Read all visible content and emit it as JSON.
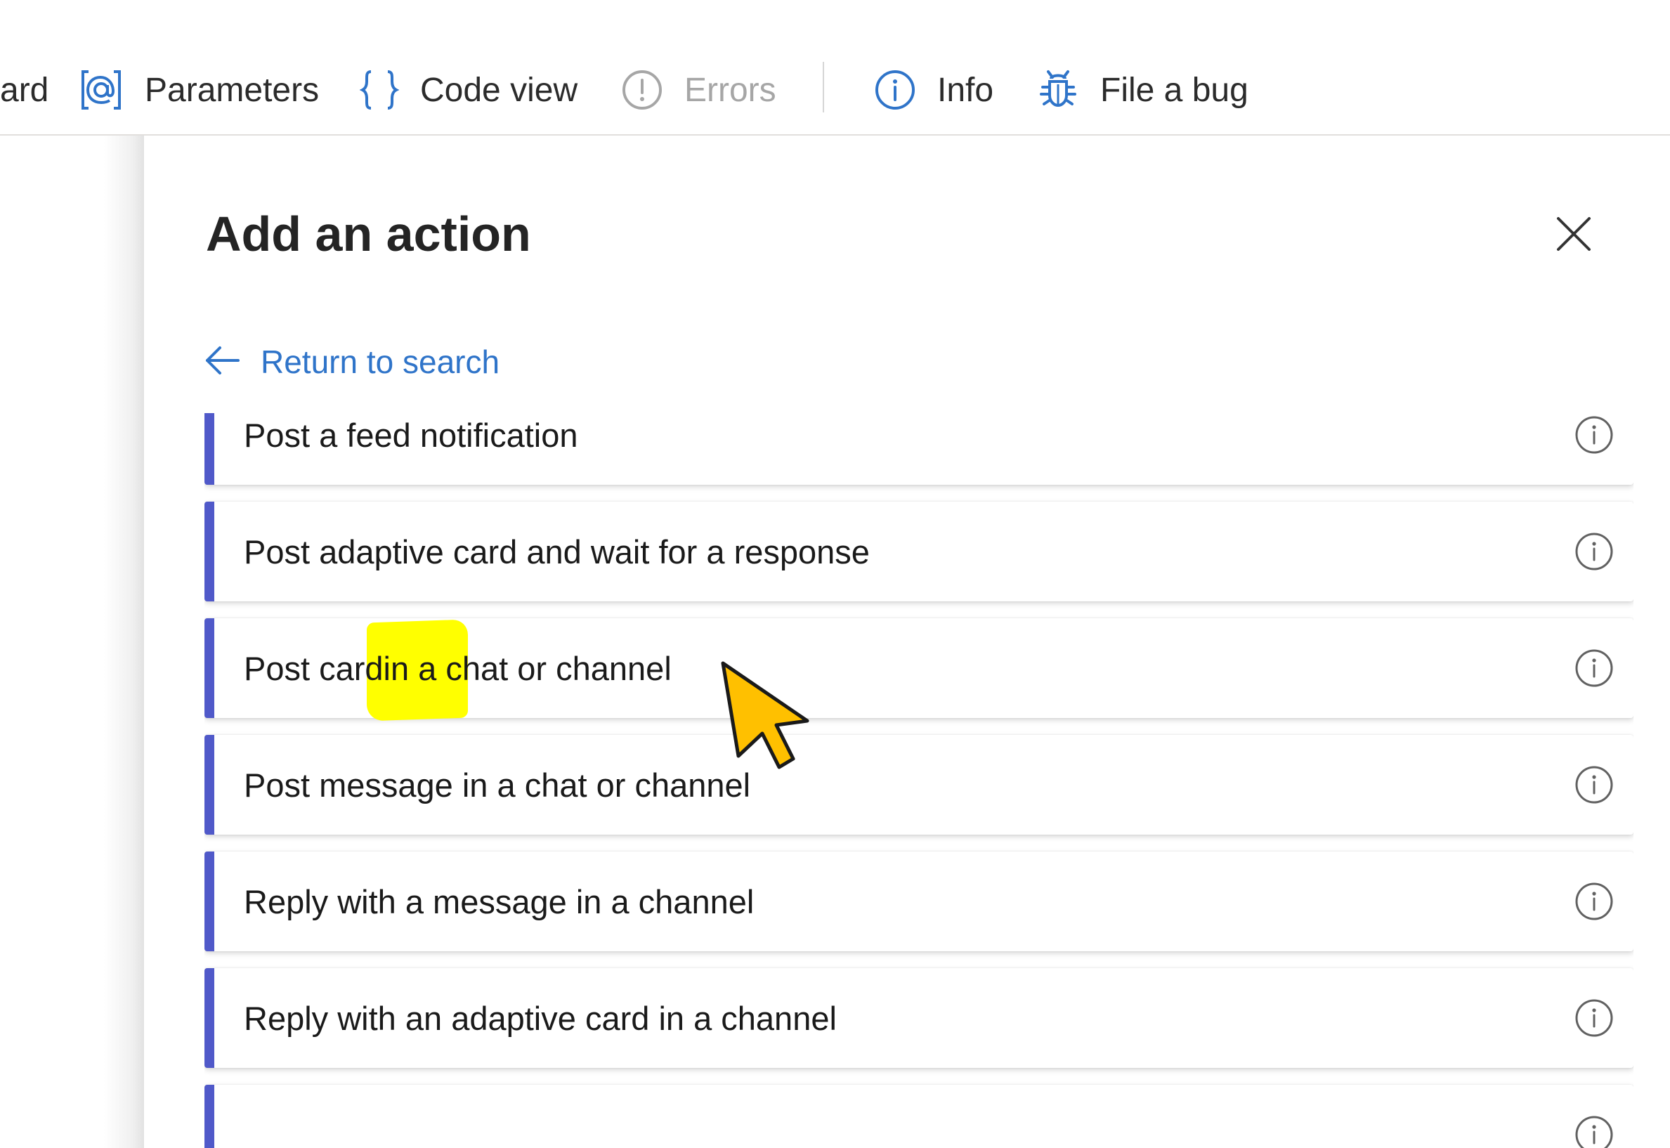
{
  "toolbar": {
    "items": [
      {
        "label": "ard",
        "icon": "none"
      },
      {
        "label": "Parameters",
        "icon": "parameters-icon"
      },
      {
        "label": "Code view",
        "icon": "braces-icon"
      },
      {
        "label": "Errors",
        "icon": "error-icon",
        "state": "disabled"
      },
      {
        "label": "Info",
        "icon": "info-icon"
      },
      {
        "label": "File a bug",
        "icon": "bug-icon"
      }
    ]
  },
  "panel": {
    "title": "Add an action",
    "return_label": "Return to search",
    "results": [
      {
        "label": "Post a feed notification"
      },
      {
        "label": "Post adaptive card and wait for a response"
      },
      {
        "label_before": "Pos",
        "label_highlight": "t card",
        "label_after": " in a chat or channel"
      },
      {
        "label": "Post message in a chat or channel"
      },
      {
        "label": "Reply with a message in a channel"
      },
      {
        "label": "Reply with an adaptive card in a channel"
      }
    ]
  },
  "colors": {
    "accent_link": "#2f74c9",
    "card_accent": "#5059c9",
    "highlight": "#ffff00",
    "cursor": "#ffc000"
  }
}
